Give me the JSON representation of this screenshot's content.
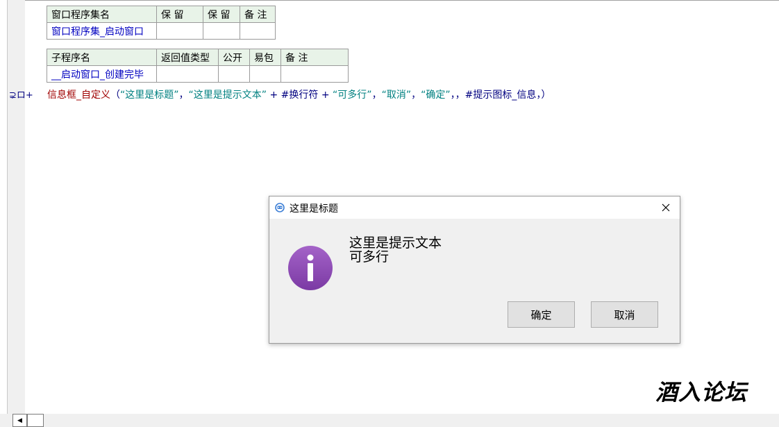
{
  "assembly_table": {
    "headers": [
      "窗口程序集名",
      "保 留",
      "保 留",
      "备 注"
    ],
    "row": [
      "窗口程序集_启动窗口",
      "",
      "",
      ""
    ]
  },
  "sub_table": {
    "headers": [
      "子程序名",
      "返回值类型",
      "公开",
      "易包",
      "备 注"
    ],
    "row": [
      "__启动窗口_创建完毕",
      "",
      "",
      "",
      ""
    ]
  },
  "code": {
    "gutter_text": "⊋ロ+",
    "func": "信息框_自定义",
    "open_paren": "（",
    "arg1": "“这里是标题”",
    "comma1": "，",
    "arg2": "“这里是提示文本”",
    "plus1": " + ",
    "const1": "#换行符",
    "plus2": " + ",
    "arg3": "“可多行”",
    "comma2": "，",
    "arg4": "“取消”",
    "comma3": "，",
    "arg5": "“确定”",
    "commas": "，，",
    "const2": "#提示图标_信息",
    "close": "，）"
  },
  "dialog": {
    "title": "这里是标题",
    "message_line1": "这里是提示文本",
    "message_line2": "可多行",
    "ok_label": "确定",
    "cancel_label": "取消"
  },
  "watermark": "酒入论坛",
  "colors": {
    "info_icon": "#8e44ad",
    "keyword": "#a00000",
    "string": "#008080",
    "constant": "#000080"
  }
}
